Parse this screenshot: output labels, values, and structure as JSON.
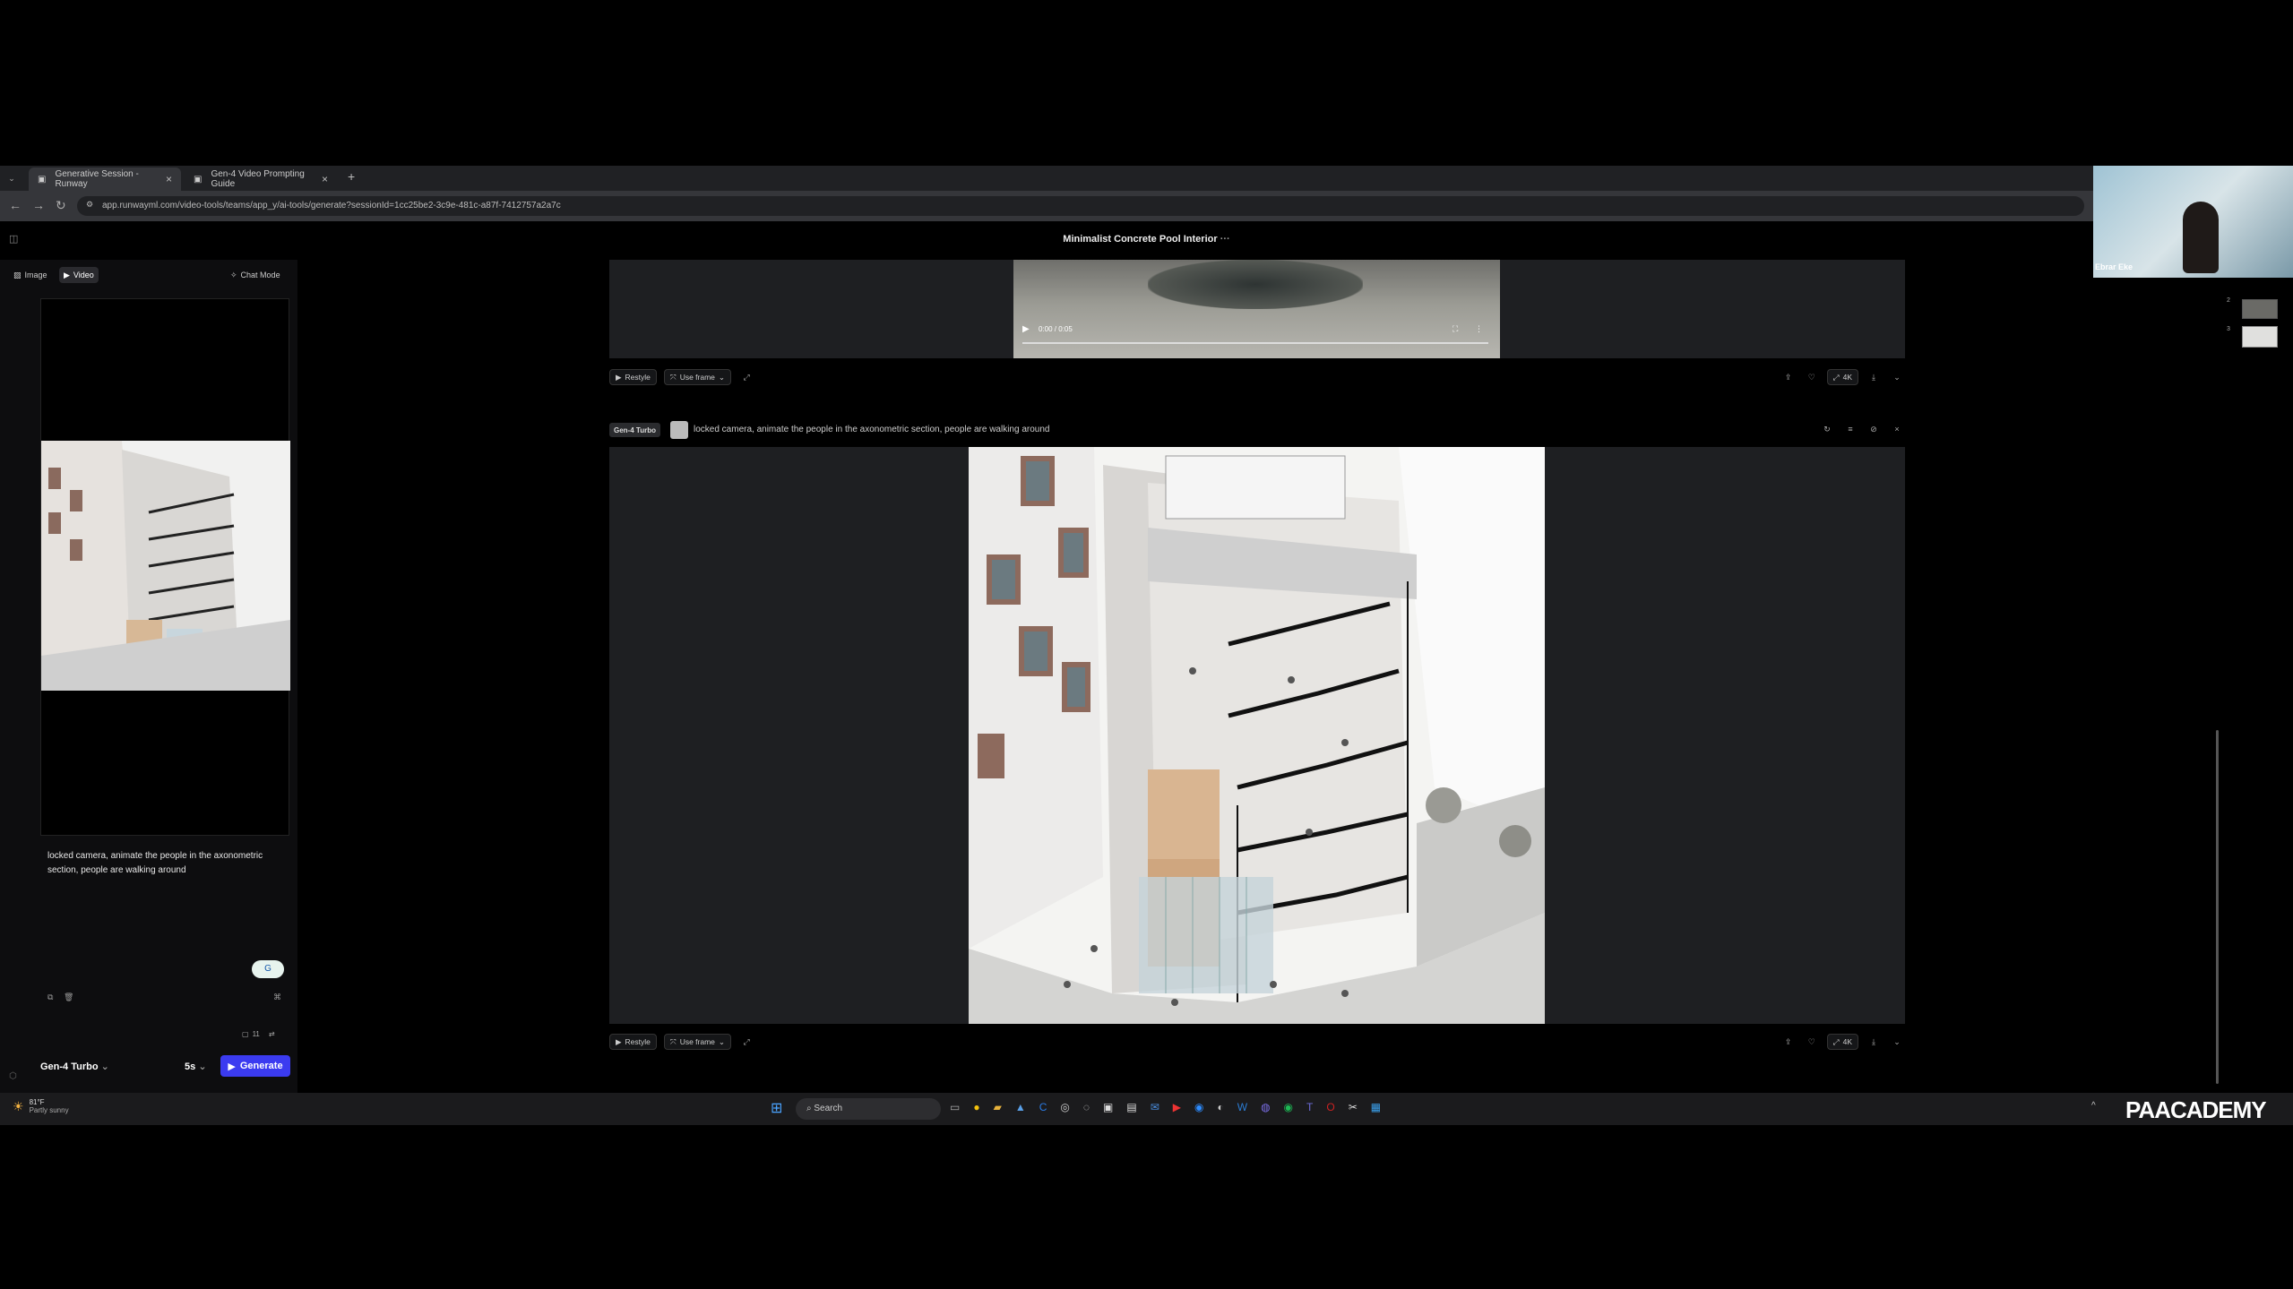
{
  "browser": {
    "tabs": [
      {
        "title": "Generative Session - Runway",
        "active": true
      },
      {
        "title": "Gen-4 Video Prompting Guide",
        "active": false
      }
    ],
    "url": "app.runwayml.com/video-tools/teams/app_y/ai-tools/generate?sessionId=1cc25be2-3c9e-481c-a87f-7412757a2a7c"
  },
  "app": {
    "session_title": "Minimalist Concrete Pool Interior",
    "session_menu": "···",
    "modes": {
      "image": "Image",
      "video": "Video",
      "chat": "Chat Mode"
    },
    "prompt": "locked camera, animate the people in the axonometric section, people are walking around",
    "credits": "11",
    "model": "Gen-4 Turbo",
    "duration": "5s",
    "generate_label": "Generate"
  },
  "results": [
    {
      "video_time": "0:00 / 0:05",
      "actions": {
        "restyle": "Restyle",
        "use_frame": "Use frame",
        "resolution": "4K"
      }
    },
    {
      "model": "Gen-4 Turbo",
      "prompt": "locked camera, animate the people in the axonometric section, people are walking around",
      "actions": {
        "restyle": "Restyle",
        "use_frame": "Use frame",
        "resolution": "4K"
      }
    }
  ],
  "side_thumbs": [
    "2",
    "3"
  ],
  "webcam": {
    "name": "Ebrar Eke"
  },
  "taskbar": {
    "weather_temp": "81°F",
    "weather_desc": "Partly sunny",
    "search": "Search",
    "watermark": "PAACADEMY"
  }
}
